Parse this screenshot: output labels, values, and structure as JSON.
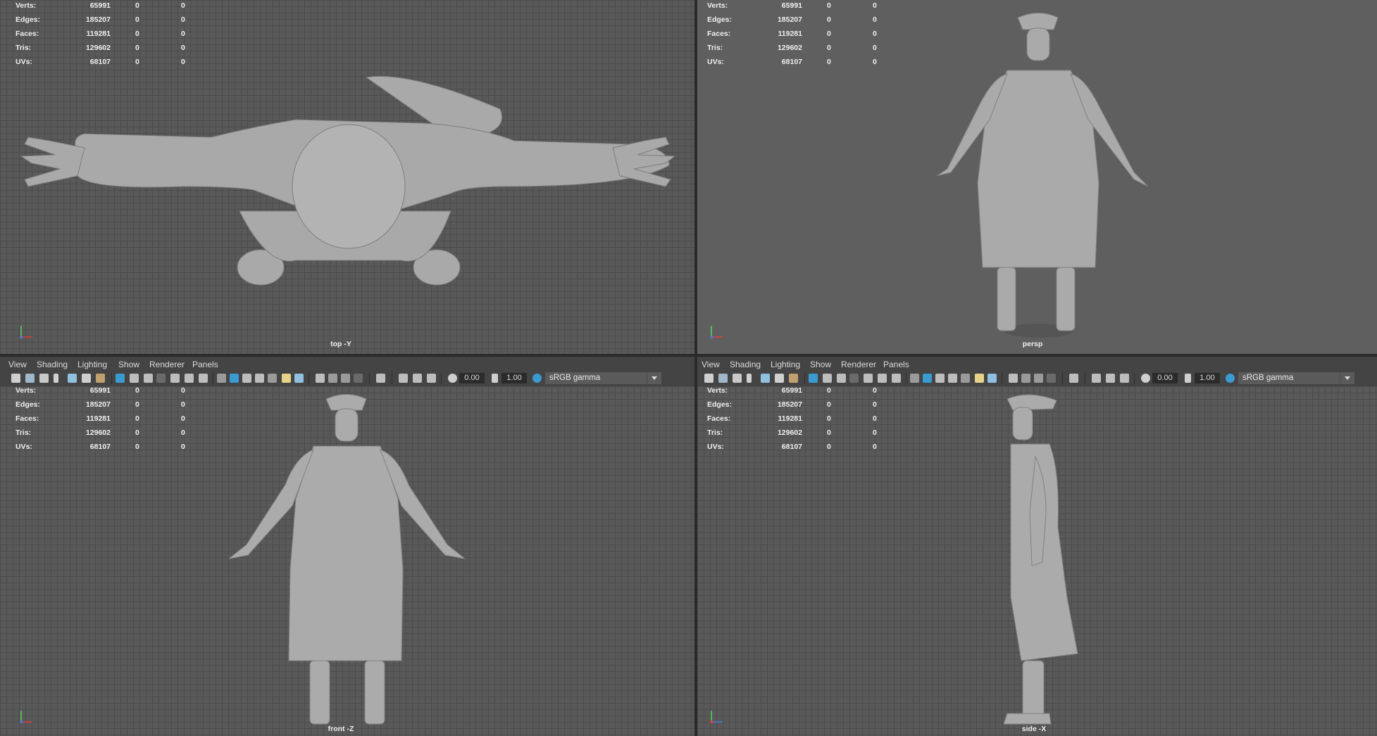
{
  "viewports": [
    {
      "id": "top",
      "label": "top -Y"
    },
    {
      "id": "persp",
      "label": "persp"
    },
    {
      "id": "front",
      "label": "front -Z"
    },
    {
      "id": "side",
      "label": "side -X"
    }
  ],
  "hud": {
    "rows": [
      {
        "label": "Verts:",
        "v1": "65991",
        "v2": "0",
        "v3": "0"
      },
      {
        "label": "Edges:",
        "v1": "185207",
        "v2": "0",
        "v3": "0"
      },
      {
        "label": "Faces:",
        "v1": "119281",
        "v2": "0",
        "v3": "0"
      },
      {
        "label": "Tris:",
        "v1": "129602",
        "v2": "0",
        "v3": "0"
      },
      {
        "label": "UVs:",
        "v1": "68107",
        "v2": "0",
        "v3": "0"
      }
    ]
  },
  "menu": {
    "view": "View",
    "shading": "Shading",
    "lighting": "Lighting",
    "show": "Show",
    "renderer": "Renderer",
    "panels": "Panels"
  },
  "toolbar": {
    "exposure": "0.00",
    "gamma": "1.00",
    "color_space": "sRGB gamma",
    "icons": [
      "camera-icon",
      "film-icon",
      "grid-icon",
      "wireframe-icon",
      "smooth-shade-icon",
      "light-icon",
      "shadow-icon",
      "isolate-icon",
      "xray-icon",
      "exposure-icon",
      "gamma-icon"
    ]
  },
  "colors": {
    "grid_bg": "#595959",
    "persp_bg": "#5f5f5f",
    "toolbar_bg": "#444444",
    "accent": "#3a9bd1",
    "model": "#a8a8a8"
  }
}
